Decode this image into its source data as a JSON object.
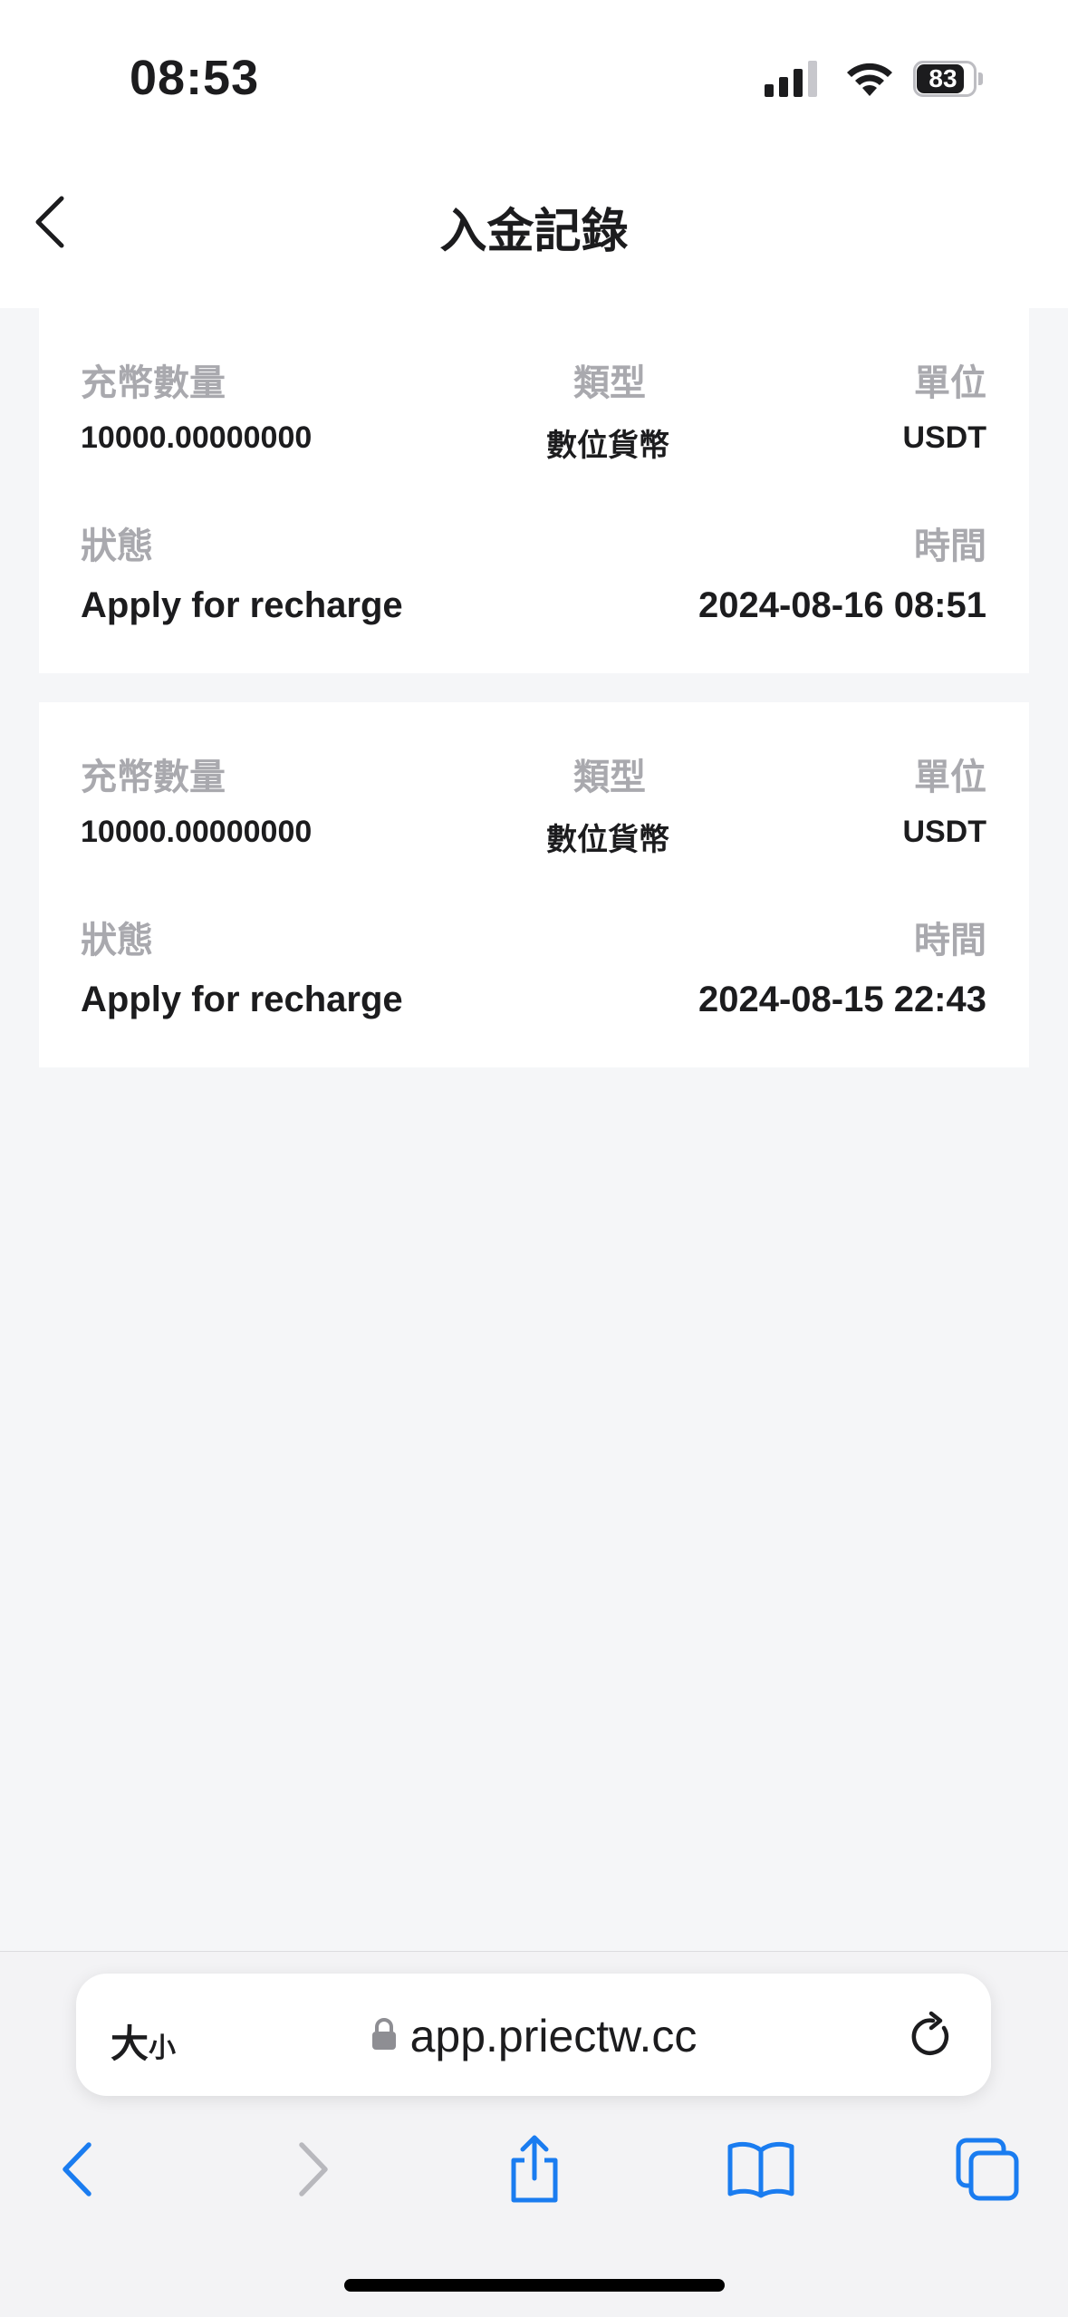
{
  "status_bar": {
    "time": "08:53",
    "battery": "83"
  },
  "header": {
    "title": "入金記錄"
  },
  "labels": {
    "amount": "充幣數量",
    "type": "類型",
    "unit": "單位",
    "status": "狀態",
    "time": "時間"
  },
  "records": [
    {
      "amount": "10000.00000000",
      "type": "數位貨幣",
      "unit": "USDT",
      "status": "Apply for recharge",
      "time": "2024-08-16 08:51"
    },
    {
      "amount": "10000.00000000",
      "type": "數位貨幣",
      "unit": "USDT",
      "status": "Apply for recharge",
      "time": "2024-08-15 22:43"
    }
  ],
  "browser": {
    "text_size_big": "大",
    "text_size_small": "小",
    "url": "app.priectw.cc"
  },
  "colors": {
    "accent": "#1a7cf0",
    "label_gray": "#a9a9ae",
    "background": "#f5f6f8"
  }
}
